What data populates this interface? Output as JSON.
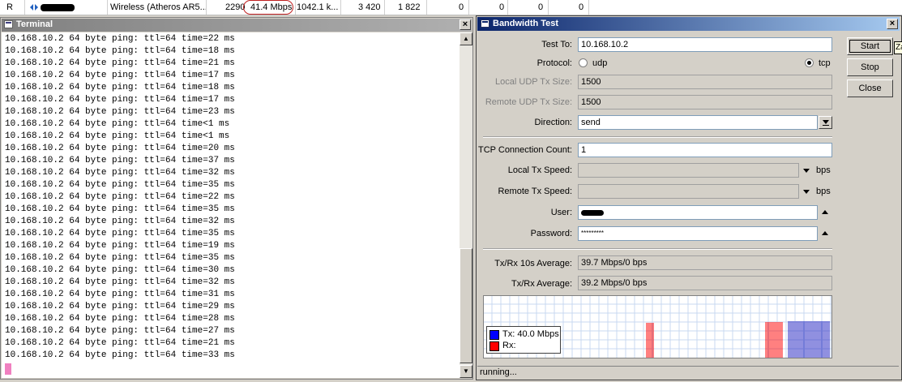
{
  "interface_row": {
    "flag": "R",
    "type": "Wireless (Atheros AR5...",
    "mtu": "2290",
    "tx_rate": "41.4 Mbps",
    "rx_rate": "1042.1 k...",
    "tx_packets": "3 420",
    "rx_packets": "1 822",
    "col_a": "0",
    "col_b": "0",
    "col_c": "0",
    "col_d": "0"
  },
  "terminal": {
    "title": "Terminal",
    "lines": [
      "10.168.10.2 64 byte ping: ttl=64 time=22 ms",
      "10.168.10.2 64 byte ping: ttl=64 time=18 ms",
      "10.168.10.2 64 byte ping: ttl=64 time=21 ms",
      "10.168.10.2 64 byte ping: ttl=64 time=17 ms",
      "10.168.10.2 64 byte ping: ttl=64 time=18 ms",
      "10.168.10.2 64 byte ping: ttl=64 time=17 ms",
      "10.168.10.2 64 byte ping: ttl=64 time=23 ms",
      "10.168.10.2 64 byte ping: ttl=64 time<1 ms",
      "10.168.10.2 64 byte ping: ttl=64 time<1 ms",
      "10.168.10.2 64 byte ping: ttl=64 time=20 ms",
      "10.168.10.2 64 byte ping: ttl=64 time=37 ms",
      "10.168.10.2 64 byte ping: ttl=64 time=32 ms",
      "10.168.10.2 64 byte ping: ttl=64 time=35 ms",
      "10.168.10.2 64 byte ping: ttl=64 time=22 ms",
      "10.168.10.2 64 byte ping: ttl=64 time=35 ms",
      "10.168.10.2 64 byte ping: ttl=64 time=32 ms",
      "10.168.10.2 64 byte ping: ttl=64 time=35 ms",
      "10.168.10.2 64 byte ping: ttl=64 time=19 ms",
      "10.168.10.2 64 byte ping: ttl=64 time=35 ms",
      "10.168.10.2 64 byte ping: ttl=64 time=30 ms",
      "10.168.10.2 64 byte ping: ttl=64 time=32 ms",
      "10.168.10.2 64 byte ping: ttl=64 time=31 ms",
      "10.168.10.2 64 byte ping: ttl=64 time=29 ms",
      "10.168.10.2 64 byte ping: ttl=64 time=28 ms",
      "10.168.10.2 64 byte ping: ttl=64 time=27 ms",
      "10.168.10.2 64 byte ping: ttl=64 time=21 ms",
      "10.168.10.2 64 byte ping: ttl=64 time=33 ms"
    ]
  },
  "bandwidth": {
    "title": "Bandwidth Test",
    "test_to_label": "Test To:",
    "test_to": "10.168.10.2",
    "protocol_label": "Protocol:",
    "protocol_udp": "udp",
    "protocol_tcp": "tcp",
    "protocol_selected": "tcp",
    "local_udp_label": "Local UDP Tx Size:",
    "local_udp": "1500",
    "remote_udp_label": "Remote UDP Tx Size:",
    "remote_udp": "1500",
    "direction_label": "Direction:",
    "direction": "send",
    "tcp_count_label": "TCP Connection Count:",
    "tcp_count": "1",
    "local_tx_label": "Local Tx Speed:",
    "local_tx_unit": "bps",
    "remote_tx_label": "Remote Tx Speed:",
    "remote_tx_unit": "bps",
    "user_label": "User:",
    "password_label": "Password:",
    "password_mask": "*********",
    "avg10_label": "Tx/Rx 10s Average:",
    "avg10": "39.7 Mbps/0 bps",
    "avg_label": "Tx/Rx Average:",
    "avg": "39.2 Mbps/0 bps",
    "start_label": "Start",
    "stop_label": "Stop",
    "close_label": "Close",
    "tooltip": "Za",
    "status": "running...",
    "legend_tx": "Tx:  40.0 Mbps",
    "legend_rx": "Rx:",
    "colors": {
      "tx": "#0000ff",
      "rx": "#ff0000",
      "grid": "#c8d8f0"
    }
  }
}
